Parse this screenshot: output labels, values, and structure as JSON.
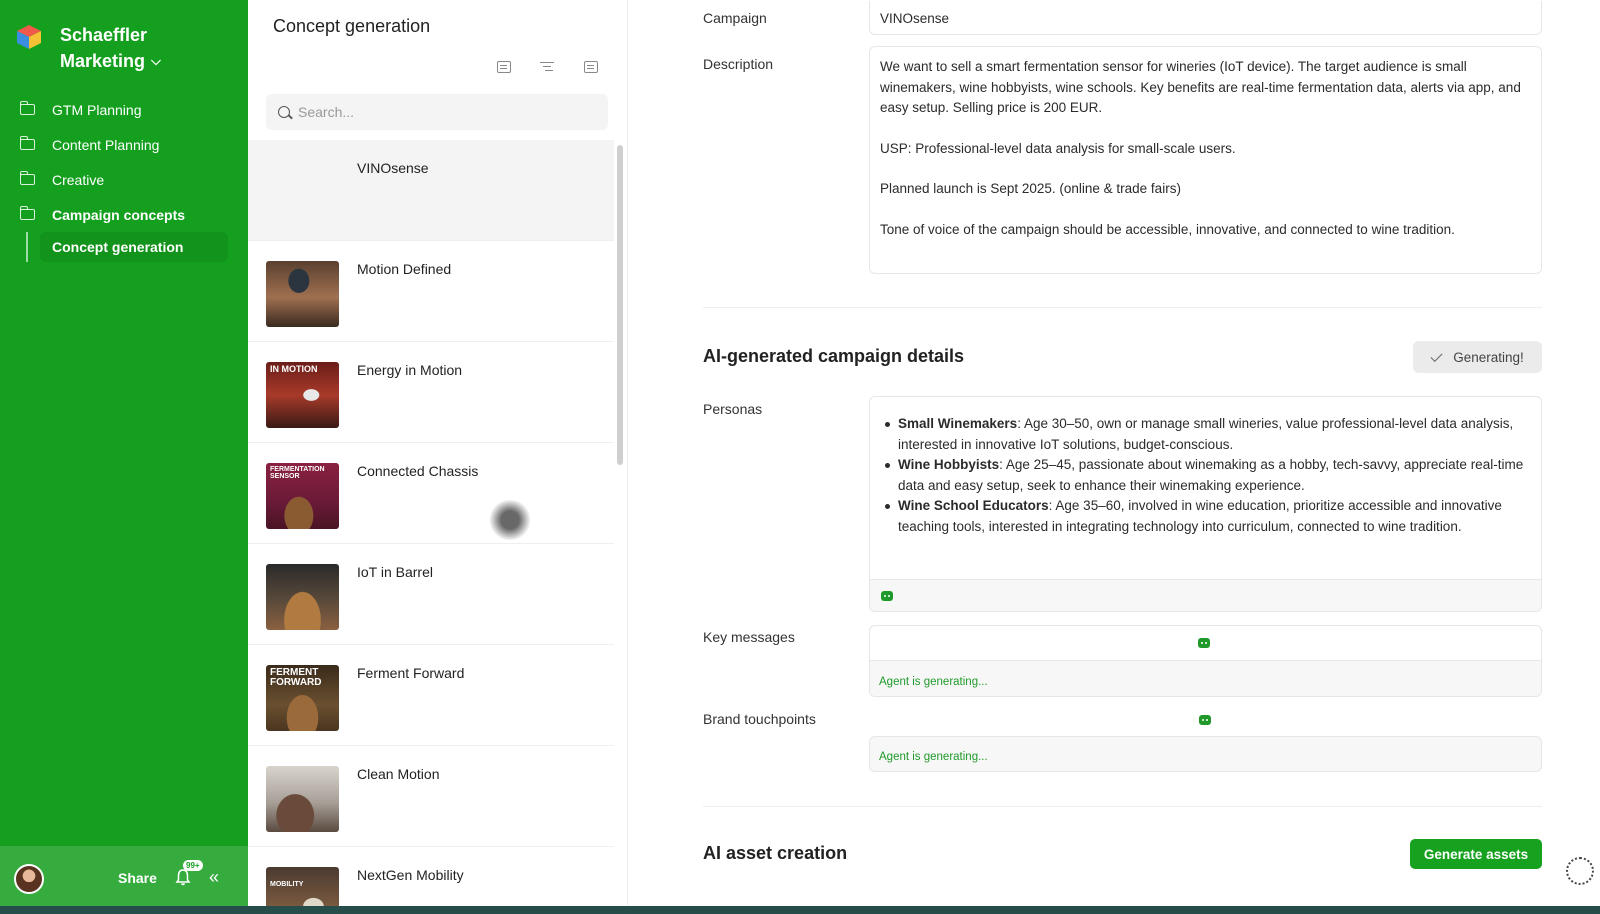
{
  "sidebar": {
    "workspace_line1": "Schaeffler",
    "workspace_line2": "Marketing",
    "items": [
      {
        "label": "GTM Planning"
      },
      {
        "label": "Content Planning"
      },
      {
        "label": "Creative"
      },
      {
        "label": "Campaign concepts"
      }
    ],
    "sub_item": "Concept generation",
    "share_label": "Share",
    "notification_badge": "99+",
    "colors": {
      "primary": "#14a01e",
      "footer": "#36ac3e"
    }
  },
  "list": {
    "title": "Concept generation",
    "search_placeholder": "Search...",
    "items": [
      {
        "label": "VINOsense"
      },
      {
        "label": "Motion Defined"
      },
      {
        "label": "Energy in Motion",
        "thumb_text": "IN MOTION"
      },
      {
        "label": "Connected Chassis",
        "thumb_text": "FERMENTATION SENSOR"
      },
      {
        "label": "IoT in Barrel"
      },
      {
        "label": "Ferment Forward",
        "thumb_text": "FERMENT FORWARD"
      },
      {
        "label": "Clean Motion"
      },
      {
        "label": "NextGen Mobility",
        "thumb_text": "MOBILITY"
      }
    ]
  },
  "main": {
    "campaign_label": "Campaign",
    "campaign_value": "VINOsense",
    "description_label": "Description",
    "description_paragraphs": [
      "We want to sell a smart fermentation sensor for wineries (IoT device). The target audience is small winemakers, wine hobbyists, wine schools. Key benefits are real-time fermentation data, alerts via app, and easy setup. Selling price is 200 EUR.",
      "USP: Professional-level data analysis for small-scale users.",
      "Planned launch is Sept 2025. (online & trade fairs)",
      "Tone of voice of the campaign should be accessible, innovative, and connected to wine tradition."
    ],
    "ai_section_title": "AI-generated campaign details",
    "generating_label": "Generating!",
    "personas_label": "Personas",
    "personas": [
      {
        "name": "Small Winemakers",
        "text": ": Age 30–50, own or manage small wineries, value professional-level data analysis, interested in innovative IoT solutions, budget-conscious."
      },
      {
        "name": "Wine Hobbyists",
        "text": ": Age 25–45, passionate about winemaking as a hobby, tech-savvy, appreciate real-time data and easy setup, seek to enhance their winemaking experience."
      },
      {
        "name": "Wine School Educators",
        "text": ": Age 35–60, involved in wine education, prioritize accessible and innovative teaching tools, interested in integrating technology into curriculum, connected to wine tradition."
      }
    ],
    "key_messages_label": "Key messages",
    "key_messages_status": "Agent is generating...",
    "brand_touchpoints_label": "Brand touchpoints",
    "brand_touchpoints_status": "Agent is generating...",
    "asset_section_title": "AI asset creation",
    "generate_assets_label": "Generate assets",
    "accent_color": "#16a11f"
  }
}
